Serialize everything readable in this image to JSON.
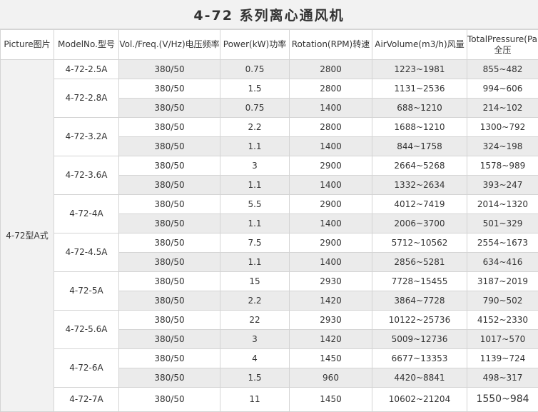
{
  "title": "4-72 系列离心通风机",
  "headers": {
    "picture": "Picture图片",
    "model": "ModelNo.型号",
    "volt": "Vol./Freq.(V/Hz)电压频率",
    "power": "Power(kW)功率",
    "rpm": "Rotation(RPM)转速",
    "air": "AirVolume(m3/h)风量",
    "pressure": "TotalPressure(Pa)全压"
  },
  "picture_cell": "4-72型A式",
  "models": [
    {
      "model": "4-72-2.5A",
      "rows": [
        {
          "volt": "380/50",
          "power": "0.75",
          "rpm": "2800",
          "air": "1223~1981",
          "pressure": "855~482"
        }
      ]
    },
    {
      "model": "4-72-2.8A",
      "rows": [
        {
          "volt": "380/50",
          "power": "1.5",
          "rpm": "2800",
          "air": "1131~2536",
          "pressure": "994~606"
        },
        {
          "volt": "380/50",
          "power": "0.75",
          "rpm": "1400",
          "air": "688~1210",
          "pressure": "214~102"
        }
      ]
    },
    {
      "model": "4-72-3.2A",
      "rows": [
        {
          "volt": "380/50",
          "power": "2.2",
          "rpm": "2800",
          "air": "1688~1210",
          "pressure": "1300~792"
        },
        {
          "volt": "380/50",
          "power": "1.1",
          "rpm": "1400",
          "air": "844~1758",
          "pressure": "324~198"
        }
      ]
    },
    {
      "model": "4-72-3.6A",
      "rows": [
        {
          "volt": "380/50",
          "power": "3",
          "rpm": "2900",
          "air": "2664~5268",
          "pressure": "1578~989"
        },
        {
          "volt": "380/50",
          "power": "1.1",
          "rpm": "1400",
          "air": "1332~2634",
          "pressure": "393~247"
        }
      ]
    },
    {
      "model": "4-72-4A",
      "rows": [
        {
          "volt": "380/50",
          "power": "5.5",
          "rpm": "2900",
          "air": "4012~7419",
          "pressure": "2014~1320"
        },
        {
          "volt": "380/50",
          "power": "1.1",
          "rpm": "1400",
          "air": "2006~3700",
          "pressure": "501~329"
        }
      ]
    },
    {
      "model": "4-72-4.5A",
      "rows": [
        {
          "volt": "380/50",
          "power": "7.5",
          "rpm": "2900",
          "air": "5712~10562",
          "pressure": "2554~1673"
        },
        {
          "volt": "380/50",
          "power": "1.1",
          "rpm": "1400",
          "air": "2856~5281",
          "pressure": "634~416"
        }
      ]
    },
    {
      "model": "4-72-5A",
      "rows": [
        {
          "volt": "380/50",
          "power": "15",
          "rpm": "2930",
          "air": "7728~15455",
          "pressure": "3187~2019"
        },
        {
          "volt": "380/50",
          "power": "2.2",
          "rpm": "1420",
          "air": "3864~7728",
          "pressure": "790~502"
        }
      ]
    },
    {
      "model": "4-72-5.6A",
      "rows": [
        {
          "volt": "380/50",
          "power": "22",
          "rpm": "2930",
          "air": "10122~25736",
          "pressure": "4152~2330"
        },
        {
          "volt": "380/50",
          "power": "3",
          "rpm": "1420",
          "air": "5009~12736",
          "pressure": "1017~570"
        }
      ]
    },
    {
      "model": "4-72-6A",
      "rows": [
        {
          "volt": "380/50",
          "power": "4",
          "rpm": "1450",
          "air": "6677~13353",
          "pressure": "1139~724"
        },
        {
          "volt": "380/50",
          "power": "1.5",
          "rpm": "960",
          "air": "4420~8841",
          "pressure": "498~317"
        }
      ]
    },
    {
      "model": "4-72-7A",
      "rows": [
        {
          "volt": "380/50",
          "power": "11",
          "rpm": "1450",
          "air": "10602~21204",
          "pressure": "1550~984"
        }
      ]
    }
  ]
}
